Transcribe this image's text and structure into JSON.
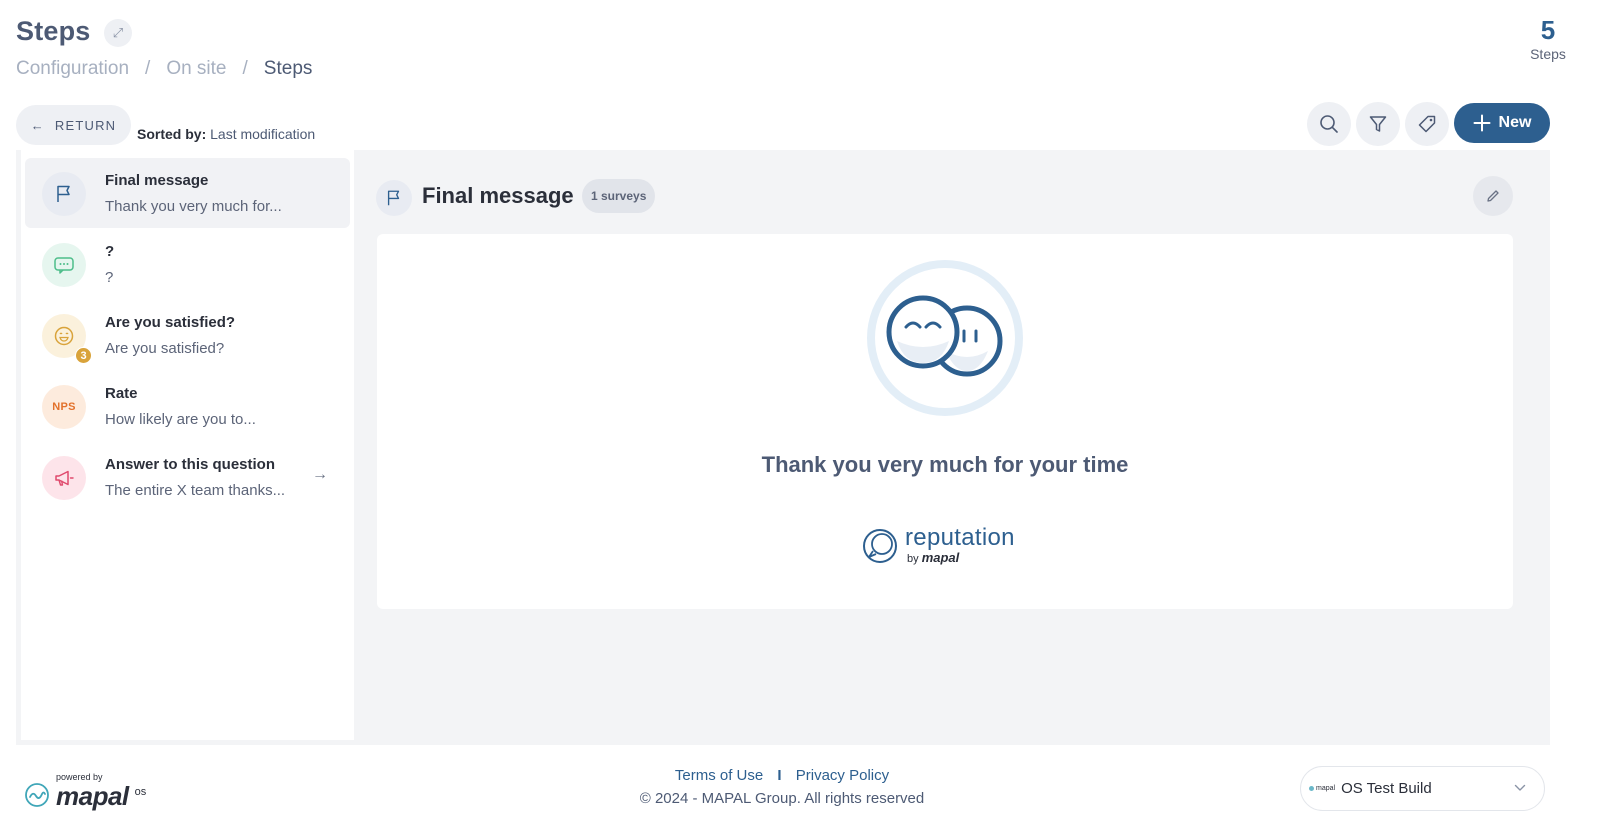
{
  "header": {
    "title": "Steps",
    "breadcrumbs": [
      "Configuration",
      "On site",
      "Steps"
    ],
    "counter_value": "5",
    "counter_label": "Steps"
  },
  "toolbar": {
    "return_label": "RETURN",
    "sorted_prefix": "Sorted by:",
    "sorted_value": "Last modification",
    "new_label": "New"
  },
  "list": {
    "items": [
      {
        "title": "Final message",
        "subtitle": "Thank you very much for...",
        "icon": "flag-icon",
        "icon_bg": "#e8ebf2",
        "icon_color": "#2d5f8f"
      },
      {
        "title": "?",
        "subtitle": "?",
        "icon": "chat-icon",
        "icon_bg": "#e6f6ef",
        "icon_color": "#4dbd8a"
      },
      {
        "title": "Are you satisfied?",
        "subtitle": "Are you satisfied?",
        "icon": "smiley-icon",
        "icon_bg": "#fbf1dc",
        "icon_color": "#d9a33a",
        "badge": "3"
      },
      {
        "title": "Rate",
        "subtitle": "How likely are you to...",
        "icon": "nps-icon",
        "icon_label": "NPS",
        "icon_bg": "#fdebdd",
        "icon_color": "#e2712b"
      },
      {
        "title": "Answer to this question",
        "subtitle": "The entire X team thanks...",
        "icon": "megaphone-icon",
        "icon_bg": "#fde4ea",
        "icon_color": "#e04a6d"
      }
    ]
  },
  "detail": {
    "title": "Final message",
    "surveys_badge": "1 surveys",
    "message": "Thank you very much for your time",
    "brand_name": "reputation",
    "brand_by": "by",
    "brand_company": "mapal"
  },
  "footer": {
    "powered_by": "powered by",
    "powered_brand": "mapal",
    "powered_os": "os",
    "terms": "Terms of Use",
    "separator": "I",
    "privacy": "Privacy Policy",
    "copyright": "© 2024 - MAPAL Group. All rights reserved",
    "env_logo": "mapal",
    "env_label": "OS Test Build"
  },
  "colors": {
    "primary": "#2d5f8f",
    "panel_bg": "#f3f4f6"
  }
}
